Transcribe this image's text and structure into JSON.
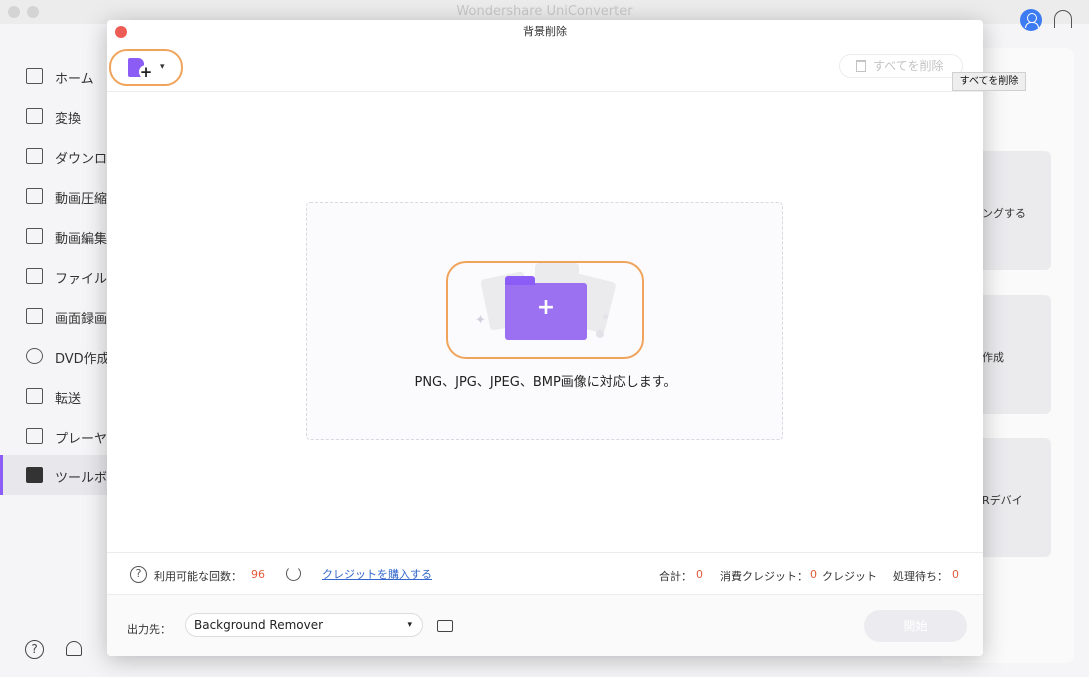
{
  "app": {
    "title": "Wondershare UniConverter"
  },
  "sidebar": {
    "items": [
      {
        "label": "ホーム"
      },
      {
        "label": "変換"
      },
      {
        "label": "ダウンロ"
      },
      {
        "label": "動画圧縮"
      },
      {
        "label": "動画編集"
      },
      {
        "label": "ファイル"
      },
      {
        "label": "画面録画"
      },
      {
        "label": "DVD作成"
      },
      {
        "label": "転送"
      },
      {
        "label": "プレーヤ"
      },
      {
        "label": "ツールボ"
      }
    ],
    "active_index": 10,
    "help_glyph": "?"
  },
  "background_cards": [
    {
      "text": "ングする"
    },
    {
      "text": "作成"
    },
    {
      "text": "Rデバイ"
    }
  ],
  "dialog": {
    "title": "背景削除",
    "add_file_plus": "+",
    "add_file_chevron": "▾",
    "delete_all_label": "すべてを削除",
    "tooltip": "すべてを削除",
    "drop_plus": "+",
    "drop_hint": "PNG、JPG、JPEG、BMP画像に対応します。",
    "footer": {
      "help_glyph": "?",
      "available_label": "利用可能な回数：",
      "available_value": "96",
      "buy_link": "クレジットを購入する",
      "total_label": "合計：",
      "total_value": "0",
      "consumed_label": "消費クレジット：",
      "consumed_value": "0",
      "consumed_unit": "クレジット",
      "pending_label": "処理待ち：",
      "pending_value": "0"
    },
    "output": {
      "label": "出力先：",
      "value": "Background Remover",
      "caret": "▾"
    },
    "start_label": "開始"
  },
  "colors": {
    "accent": "#8c5cf6",
    "highlight": "#f0a45b",
    "count": "#e55b3b",
    "link": "#3266cc"
  }
}
